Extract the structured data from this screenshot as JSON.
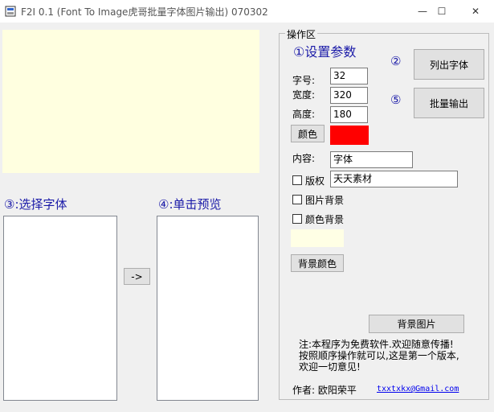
{
  "window": {
    "title": "F2I 0.1 (Font To Image虎哥批量字体图片输出)  070302",
    "minimize_glyph": "—",
    "maximize_glyph": "☐",
    "close_glyph": "✕"
  },
  "left": {
    "step3_label": "③:选择字体",
    "step4_label": "④:单击预览",
    "arrow_button": "->"
  },
  "group": {
    "title": "操作区",
    "step1_label": "①设置参数",
    "step2_label": "②",
    "step5_label": "⑤",
    "list_fonts_button": "列出字体",
    "batch_output_button": "批量输出",
    "font_size_label": "字号:",
    "font_size_value": "32",
    "width_label": "宽度:",
    "width_value": "320",
    "height_label": "高度:",
    "height_value": "180",
    "color_button": "颜色",
    "text_color": "#ff0000",
    "content_label": "内容:",
    "content_value": "字体",
    "copyright_label": "版权",
    "copyright_value": "天天素材",
    "image_bg_label": "图片背景",
    "color_bg_label": "颜色背景",
    "bg_color": "#ffffe5",
    "bg_color_button": "背景颜色",
    "bg_image_button": "背景图片",
    "note_line1": "注:本程序为免费软件.欢迎随意传播!",
    "note_line2": "按照顺序操作就可以,这是第一个版本,",
    "note_line3": "欢迎一切意见!",
    "author_label": "作者: 欧阳荣平",
    "email": "txxtxkx@Gmail.com"
  }
}
